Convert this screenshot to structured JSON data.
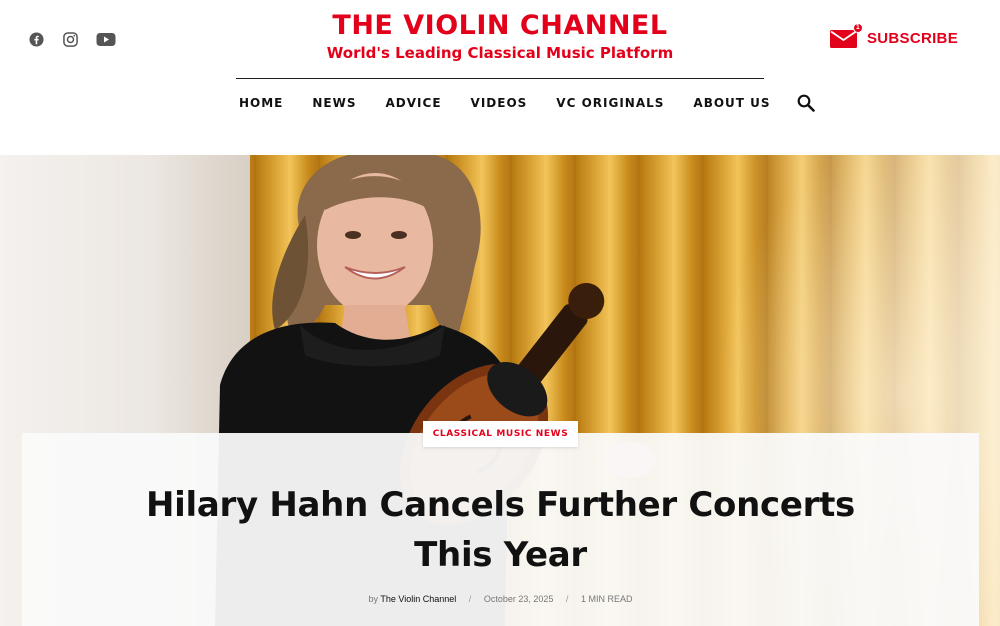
{
  "brand": {
    "title": "THE VIOLIN CHANNEL",
    "tagline": "World's Leading Classical Music Platform",
    "accent_color": "#e3001b"
  },
  "social": [
    {
      "icon": "facebook-icon"
    },
    {
      "icon": "instagram-icon"
    },
    {
      "icon": "youtube-icon"
    }
  ],
  "subscribe": {
    "label": "SUBSCRIBE",
    "badge": "1",
    "icon": "envelope-icon"
  },
  "nav": {
    "items": [
      "HOME",
      "NEWS",
      "ADVICE",
      "VIDEOS",
      "VC ORIGINALS",
      "ABOUT US"
    ],
    "search_icon": "search-icon"
  },
  "article": {
    "category": "CLASSICAL MUSIC NEWS",
    "headline": "Hilary Hahn Cancels Further Concerts This Year",
    "by_label": "by",
    "author": "The Violin Channel",
    "date": "October 23, 2025",
    "read_time": "1 MIN READ",
    "separator": "/"
  }
}
